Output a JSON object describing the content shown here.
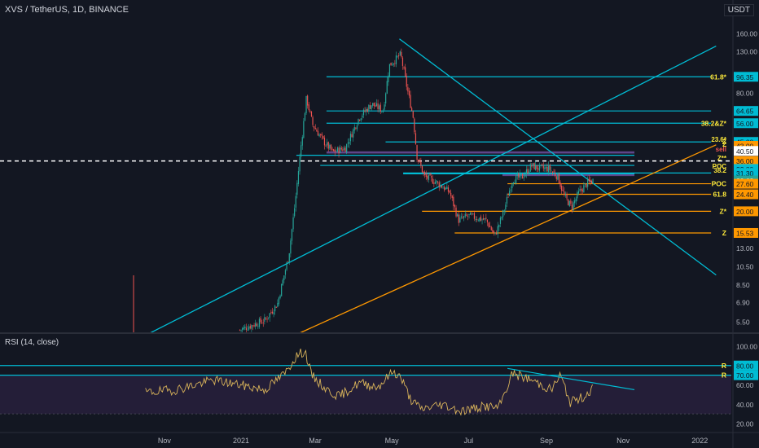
{
  "header": {
    "title": "XVS / TetherUS, 1D, BINANCE",
    "currency": "USDT",
    "rsi_title": "RSI (14, close)"
  },
  "colors": {
    "background": "#131722",
    "up": "#26a69a",
    "down": "#ef5350",
    "cyan": "#00bcd4",
    "orange": "#ff9800",
    "yellow": "#ffeb3b",
    "purple": "#9c6ade",
    "rsi_line": "#d8b35a",
    "rsi_band": "#241e38",
    "current_price": "#26a69a"
  },
  "chart_data": [
    {
      "type": "candlestick",
      "title": "XVS / TetherUS, 1D, BINANCE",
      "y_scale": "log",
      "ylim": [
        4.8,
        185
      ],
      "y_ticks": [
        "160.00",
        "130.00",
        "80.00",
        "64.65",
        "56.00",
        "45.00",
        "43.00",
        "40.50",
        "36.00",
        "32.80",
        "31.30",
        "28.68",
        "27.60",
        "24.40",
        "20.00",
        "15.53",
        "13.00",
        "10.50",
        "8.50",
        "6.90",
        "5.50"
      ],
      "x_ticks": [
        "Nov",
        "2021",
        "Mar",
        "May",
        "Jul",
        "Sep",
        "Nov",
        "2022"
      ],
      "price_path": [
        {
          "date": "2020-12-31",
          "price": 5.0
        },
        {
          "date": "2021-01-20",
          "price": 5.6
        },
        {
          "date": "2021-01-30",
          "price": 6.8
        },
        {
          "date": "2021-02-08",
          "price": 12
        },
        {
          "date": "2021-02-13",
          "price": 22
        },
        {
          "date": "2021-02-18",
          "price": 45
        },
        {
          "date": "2021-02-22",
          "price": 75
        },
        {
          "date": "2021-02-27",
          "price": 55
        },
        {
          "date": "2021-03-08",
          "price": 45
        },
        {
          "date": "2021-03-15",
          "price": 40
        },
        {
          "date": "2021-03-25",
          "price": 42
        },
        {
          "date": "2021-04-05",
          "price": 60
        },
        {
          "date": "2021-04-15",
          "price": 70
        },
        {
          "date": "2021-04-24",
          "price": 65
        },
        {
          "date": "2021-04-29",
          "price": 110
        },
        {
          "date": "2021-05-08",
          "price": 125
        },
        {
          "date": "2021-05-13",
          "price": 85
        },
        {
          "date": "2021-05-18",
          "price": 60
        },
        {
          "date": "2021-05-21",
          "price": 38
        },
        {
          "date": "2021-05-27",
          "price": 30
        },
        {
          "date": "2021-06-06",
          "price": 28
        },
        {
          "date": "2021-06-16",
          "price": 25
        },
        {
          "date": "2021-06-23",
          "price": 18
        },
        {
          "date": "2021-07-01",
          "price": 19
        },
        {
          "date": "2021-07-15",
          "price": 18
        },
        {
          "date": "2021-07-22",
          "price": 15
        },
        {
          "date": "2021-07-29",
          "price": 20
        },
        {
          "date": "2021-08-05",
          "price": 29
        },
        {
          "date": "2021-08-13",
          "price": 30
        },
        {
          "date": "2021-08-20",
          "price": 34
        },
        {
          "date": "2021-08-27",
          "price": 33
        },
        {
          "date": "2021-09-03",
          "price": 33
        },
        {
          "date": "2021-09-10",
          "price": 30
        },
        {
          "date": "2021-09-15",
          "price": 24
        },
        {
          "date": "2021-09-21",
          "price": 21
        },
        {
          "date": "2021-09-27",
          "price": 25
        },
        {
          "date": "2021-10-04",
          "price": 28
        },
        {
          "date": "2021-10-08",
          "price": 28.68
        }
      ],
      "horizontal_levels": [
        {
          "price": 96.35,
          "label": "61.8*",
          "color": "cyan",
          "from": "2021-03-10",
          "to": "2022-01-10"
        },
        {
          "price": 64.65,
          "label": "",
          "color": "cyan",
          "from": "2021-03-10",
          "to": "2022-01-10"
        },
        {
          "price": 56.0,
          "label": "38.2&Z*",
          "color": "cyan",
          "from": "2021-03-10",
          "to": "2022-01-10"
        },
        {
          "price": 45.0,
          "label": "Z",
          "color": "cyan",
          "from": "2021-04-26",
          "to": "2022-01-10"
        },
        {
          "price": 38.5,
          "label": "",
          "color": "cyan",
          "from": "2021-02-14",
          "to": "2021-11-10"
        },
        {
          "price": 34.2,
          "label": "",
          "color": "cyan",
          "from": "2021-03-05",
          "to": "2021-11-10"
        },
        {
          "price": 31.3,
          "label": "",
          "color": "cyan",
          "from": "2021-05-10",
          "to": "2022-01-10"
        },
        {
          "price": 31.0,
          "label": "",
          "color": "cyan",
          "from": "2021-05-10",
          "to": "2021-11-10"
        },
        {
          "price": 27.6,
          "label": "POC",
          "color": "orange",
          "from": "2021-08-01",
          "to": "2022-01-10"
        },
        {
          "price": 24.4,
          "label": "61.8",
          "color": "orange",
          "from": "2021-08-01",
          "to": "2022-01-10"
        },
        {
          "price": 20.0,
          "label": "Z*",
          "color": "orange",
          "from": "2021-05-25",
          "to": "2022-01-10"
        },
        {
          "price": 15.53,
          "label": "Z",
          "color": "orange",
          "from": "2021-06-20",
          "to": "2022-01-10"
        }
      ],
      "right_annotations": [
        "23.6*",
        "Z",
        "sell",
        "Z**",
        "POC",
        "38.2"
      ],
      "zones": [
        {
          "from_price": 39.3,
          "to_price": 40.3,
          "color": "purple",
          "from": "2021-03-10",
          "to": "2021-11-10"
        },
        {
          "from_price": 30.2,
          "to_price": 31.3,
          "color": "purple",
          "from": "2021-07-28",
          "to": "2021-11-10"
        }
      ],
      "current_price": 28.68,
      "dashed_level": 36.0,
      "trendlines": [
        {
          "color": "cyan",
          "from": {
            "date": "2020-10-20",
            "price": 4.8
          },
          "to": {
            "date": "2022-01-14",
            "price": 138
          }
        },
        {
          "color": "cyan",
          "from": {
            "date": "2021-05-07",
            "price": 150
          },
          "to": {
            "date": "2022-01-14",
            "price": 9.5
          }
        },
        {
          "color": "orange",
          "from": {
            "date": "2021-02-16",
            "price": 4.8
          },
          "to": {
            "date": "2022-01-14",
            "price": 43.5
          }
        }
      ]
    },
    {
      "type": "line",
      "title": "RSI (14, close)",
      "ylim": [
        15,
        105
      ],
      "y_ticks": [
        "100.00",
        "80.00",
        "70.00",
        "60.00",
        "40.00",
        "20.00"
      ],
      "levels": [
        {
          "value": 80,
          "label": "R"
        },
        {
          "value": 70,
          "label": "R"
        }
      ],
      "band": [
        30,
        70
      ],
      "series": [
        {
          "date": "2020-10-17",
          "value": 52
        },
        {
          "date": "2020-11-10",
          "value": 55
        },
        {
          "date": "2020-12-10",
          "value": 65
        },
        {
          "date": "2020-12-31",
          "value": 60
        },
        {
          "date": "2021-01-20",
          "value": 55
        },
        {
          "date": "2021-02-05",
          "value": 72
        },
        {
          "date": "2021-02-14",
          "value": 90
        },
        {
          "date": "2021-02-21",
          "value": 95
        },
        {
          "date": "2021-02-26",
          "value": 70
        },
        {
          "date": "2021-03-10",
          "value": 55
        },
        {
          "date": "2021-03-20",
          "value": 48
        },
        {
          "date": "2021-04-05",
          "value": 62
        },
        {
          "date": "2021-04-20",
          "value": 58
        },
        {
          "date": "2021-05-02",
          "value": 74
        },
        {
          "date": "2021-05-08",
          "value": 68
        },
        {
          "date": "2021-05-16",
          "value": 45
        },
        {
          "date": "2021-05-24",
          "value": 35
        },
        {
          "date": "2021-06-10",
          "value": 40
        },
        {
          "date": "2021-06-25",
          "value": 33
        },
        {
          "date": "2021-07-15",
          "value": 38
        },
        {
          "date": "2021-07-25",
          "value": 36
        },
        {
          "date": "2021-08-05",
          "value": 72
        },
        {
          "date": "2021-08-20",
          "value": 65
        },
        {
          "date": "2021-09-05",
          "value": 55
        },
        {
          "date": "2021-09-12",
          "value": 70
        },
        {
          "date": "2021-09-20",
          "value": 42
        },
        {
          "date": "2021-10-01",
          "value": 48
        },
        {
          "date": "2021-10-08",
          "value": 57
        }
      ],
      "trendline": {
        "from": {
          "date": "2021-08-01",
          "value": 77
        },
        "to": {
          "date": "2021-11-10",
          "value": 55
        }
      }
    }
  ]
}
